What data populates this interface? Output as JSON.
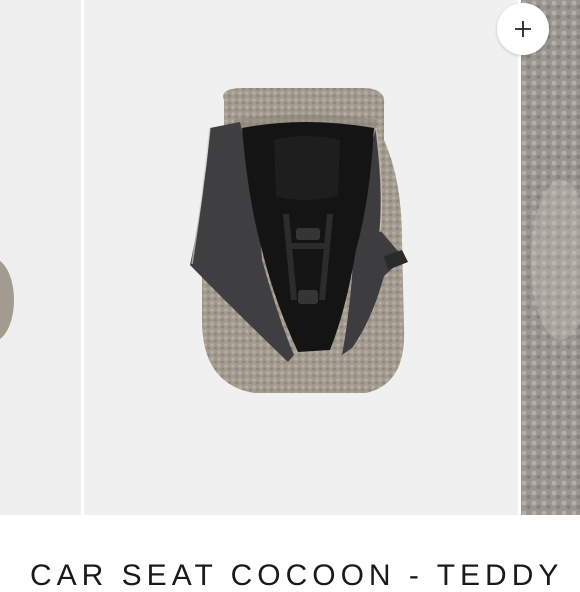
{
  "carousel": {
    "zoom_icon": "plus-icon",
    "slides": [
      {
        "name": "previous-product-image"
      },
      {
        "name": "car-seat-cocoon-image"
      },
      {
        "name": "teddy-fabric-closeup-image"
      }
    ]
  },
  "product": {
    "title": "CAR SEAT COCOON - TEDDY"
  },
  "colors": {
    "teddy": "#a39a8f",
    "lining": "#3d3d3f",
    "seat": "#141414",
    "background": "#f0f0f0"
  }
}
